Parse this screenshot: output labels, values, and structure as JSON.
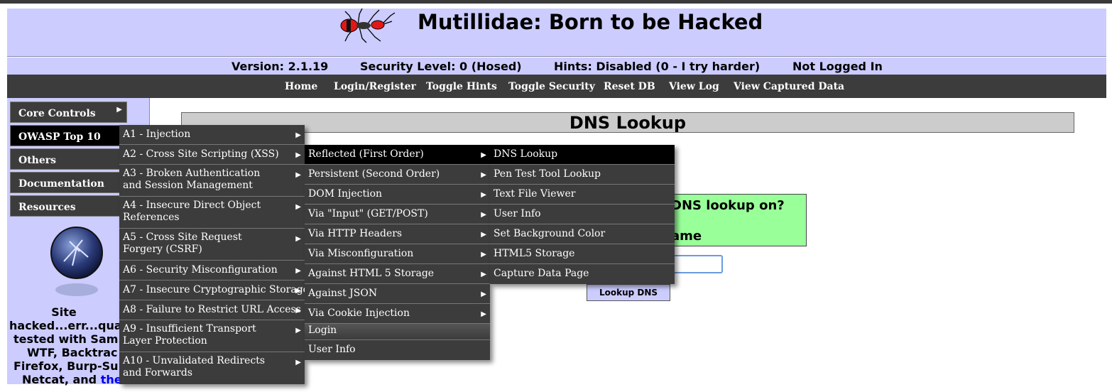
{
  "app": {
    "title": "Mutillidae: Born to be Hacked",
    "version": "Version: 2.1.19",
    "security_level": "Security Level: 0 (Hosed)",
    "hints": "Hints: Disabled (0 - I try harder)",
    "login_status": "Not Logged In"
  },
  "nav": {
    "items": [
      "Home",
      "Login/Register",
      "Toggle Hints",
      "Toggle Security",
      "Reset DB",
      "View Log",
      "View Captured Data"
    ]
  },
  "left_menu": {
    "items": [
      "Core Controls",
      "OWASP Top 10",
      "Others",
      "Documentation",
      "Resources"
    ],
    "active": "OWASP Top 10"
  },
  "owasp_menu": {
    "items": [
      "A1 - Injection",
      "A2 - Cross Site Scripting (XSS)",
      "A3 - Broken Authentication and Session Management",
      "A4 - Insecure Direct Object References",
      "A5 - Cross Site Request Forgery (CSRF)",
      "A6 - Security Misconfiguration",
      "A7 - Insecure Cryptographic Storage",
      "A8 - Failure to Restrict URL Access",
      "A9 - Insufficient Transport Layer Protection",
      "A10 - Unvalidated Redirects and Forwards"
    ]
  },
  "xss_menu": {
    "items": [
      "Reflected (First Order)",
      "Persistent (Second Order)",
      "DOM Injection",
      "Via \"Input\" (GET/POST)",
      "Via HTTP Headers",
      "Via Misconfiguration",
      "Against HTML 5 Storage",
      "Against JSON",
      "Via Cookie Injection",
      "Login",
      "User Info"
    ]
  },
  "reflected_menu": {
    "items": [
      "DNS Lookup",
      "Pen Test Tool Lookup",
      "Text File Viewer",
      "User Info",
      "Set Background Color",
      "HTML5 Storage",
      "Capture Data Page"
    ]
  },
  "sidebar_text": {
    "lines": [
      "Site",
      "hacked...err...qua",
      "tested with Sam",
      "WTF, Backtrac",
      "Firefox, Burp-Su",
      "Netcat, and "
    ],
    "link": "the"
  },
  "main": {
    "page_title": "DNS Lookup",
    "prompt_line1": "DNS lookup on?",
    "prompt_line2": "ame",
    "button_label": "Lookup DNS",
    "hostname_value": ""
  },
  "icons": {
    "logo": "ant-logo-icon",
    "owasp": "owasp-wasp-icon",
    "submenu": "arrow-right-icon"
  },
  "colors": {
    "header_bg": "#ccccff",
    "nav_bg": "#3c3c3c",
    "highlight": "#000000",
    "green_box": "#99ff99"
  }
}
